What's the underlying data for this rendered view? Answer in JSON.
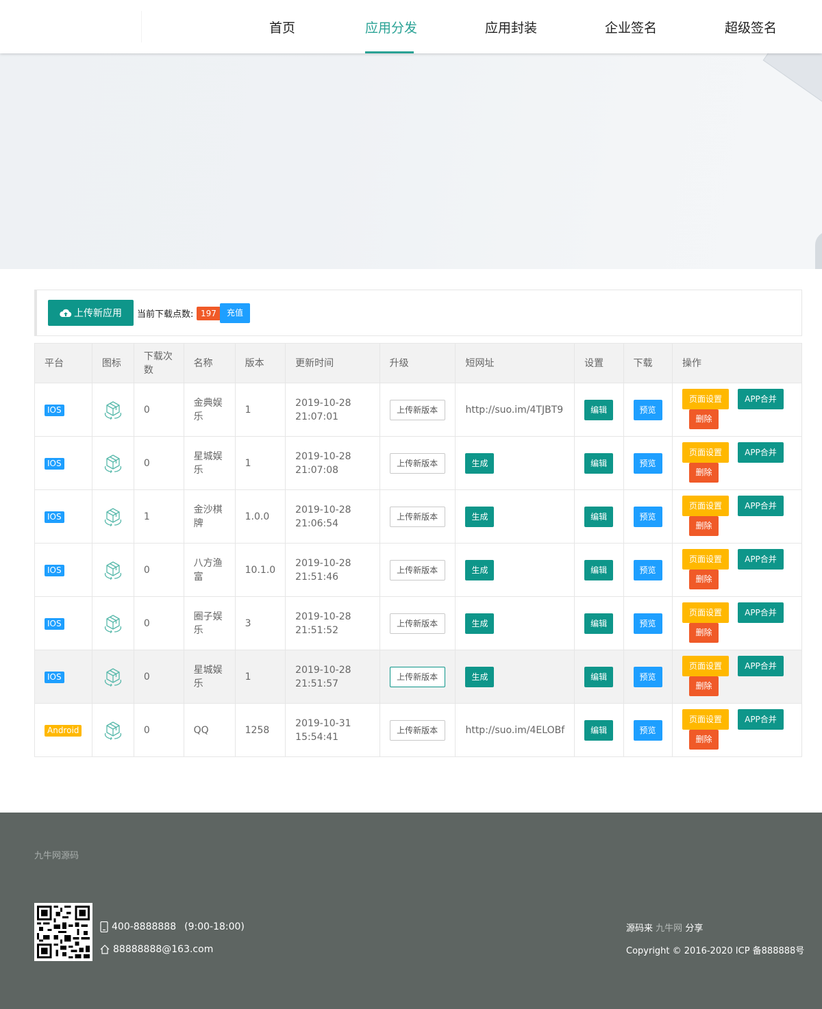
{
  "nav": {
    "items": [
      "首页",
      "应用分发",
      "应用封装",
      "企业签名",
      "超级签名"
    ],
    "active_index": 1
  },
  "toolbar": {
    "upload_label": "上传新应用",
    "points_label": "当前下载点数:",
    "points_value": "197",
    "recharge_label": "充值"
  },
  "table": {
    "headers": [
      "平台",
      "图标",
      "下载次数",
      "名称",
      "版本",
      "更新时间",
      "升级",
      "短网址",
      "设置",
      "下载",
      "操作"
    ],
    "upgrade_label": "上传新版本",
    "generate_label": "生成",
    "edit_label": "编辑",
    "preview_label": "预览",
    "page_settings_label": "页面设置",
    "merge_label": "APP合并",
    "delete_label": "删除",
    "rows": [
      {
        "platform": "IOS",
        "downloads": "0",
        "name": "金典娱乐",
        "version": "1",
        "date": "2019-10-28",
        "time": "21:07:01",
        "short_url": "http://suo.im/4TJBT9"
      },
      {
        "platform": "IOS",
        "downloads": "0",
        "name": "星城娱乐",
        "version": "1",
        "date": "2019-10-28",
        "time": "21:07:08",
        "short_url": ""
      },
      {
        "platform": "IOS",
        "downloads": "1",
        "name": "金沙棋牌",
        "version": "1.0.0",
        "date": "2019-10-28",
        "time": "21:06:54",
        "short_url": ""
      },
      {
        "platform": "IOS",
        "downloads": "0",
        "name": "八方渔富",
        "version": "10.1.0",
        "date": "2019-10-28",
        "time": "21:51:46",
        "short_url": ""
      },
      {
        "platform": "IOS",
        "downloads": "0",
        "name": "圈子娱乐",
        "version": "3",
        "date": "2019-10-28",
        "time": "21:51:52",
        "short_url": ""
      },
      {
        "platform": "IOS",
        "downloads": "0",
        "name": "星城娱乐",
        "version": "1",
        "date": "2019-10-28",
        "time": "21:51:57",
        "short_url": ""
      },
      {
        "platform": "Android",
        "downloads": "0",
        "name": "QQ",
        "version": "1258",
        "date": "2019-10-31",
        "time": "15:54:41",
        "short_url": "http://suo.im/4ELOBf"
      }
    ]
  },
  "footer": {
    "brand": "九牛网源码",
    "phone": "400-8888888",
    "hours": "(9:00-18:00)",
    "email": "88888888@163.com",
    "source_prefix": "源码来",
    "source_site": "九牛网",
    "source_suffix": "分享",
    "copyright": "Copyright © 2016-2020  ICP 备888888号"
  },
  "colors": {
    "accent": "#2aa295",
    "primary_green": "#0e968a",
    "blue": "#1e9fff",
    "orange": "#ffb800",
    "red": "#f05a28",
    "footer_bg": "#5e6562"
  }
}
